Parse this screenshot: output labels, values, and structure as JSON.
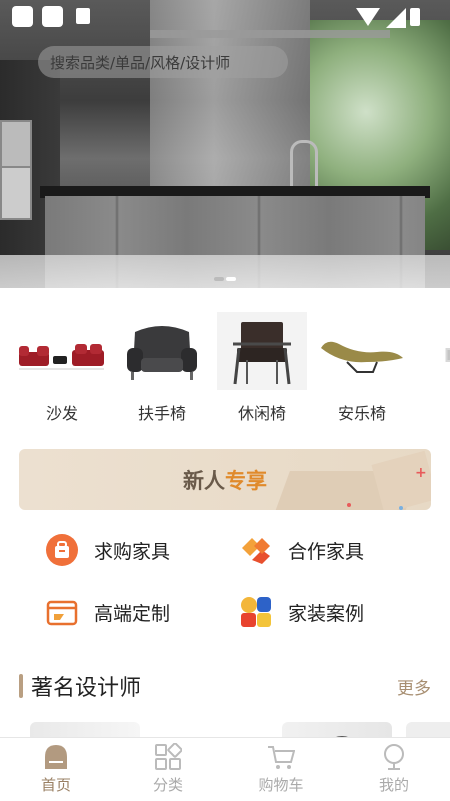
{
  "search": {
    "placeholder": "搜索品类/单品/风格/设计师"
  },
  "hero": {
    "slides": 2,
    "active_slide": 2
  },
  "categories": [
    {
      "label": "沙发",
      "icon": "red-sofa-image"
    },
    {
      "label": "扶手椅",
      "icon": "armchair-image"
    },
    {
      "label": "休闲椅",
      "icon": "lounge-chair-image"
    },
    {
      "label": "安乐椅",
      "icon": "chaise-image"
    }
  ],
  "banner": {
    "text_a": "新人",
    "text_b": "专享",
    "accent": "#e08a2b"
  },
  "features": [
    {
      "label": "求购家具",
      "icon": "shopping-bag-icon"
    },
    {
      "label": "合作家具",
      "icon": "handshake-icon"
    },
    {
      "label": "高端定制",
      "icon": "custom-box-icon"
    },
    {
      "label": "家装案例",
      "icon": "tiles-icon"
    }
  ],
  "designers": {
    "title": "著名设计师",
    "more": "更多"
  },
  "tabs": [
    {
      "label": "首页",
      "icon": "home-icon",
      "active": true
    },
    {
      "label": "分类",
      "icon": "category-icon",
      "active": false
    },
    {
      "label": "购物车",
      "icon": "cart-icon",
      "active": false
    },
    {
      "label": "我的",
      "icon": "profile-icon",
      "active": false
    }
  ],
  "colors": {
    "brand": "#9a8064",
    "tab_inactive": "#aaaaaa"
  }
}
